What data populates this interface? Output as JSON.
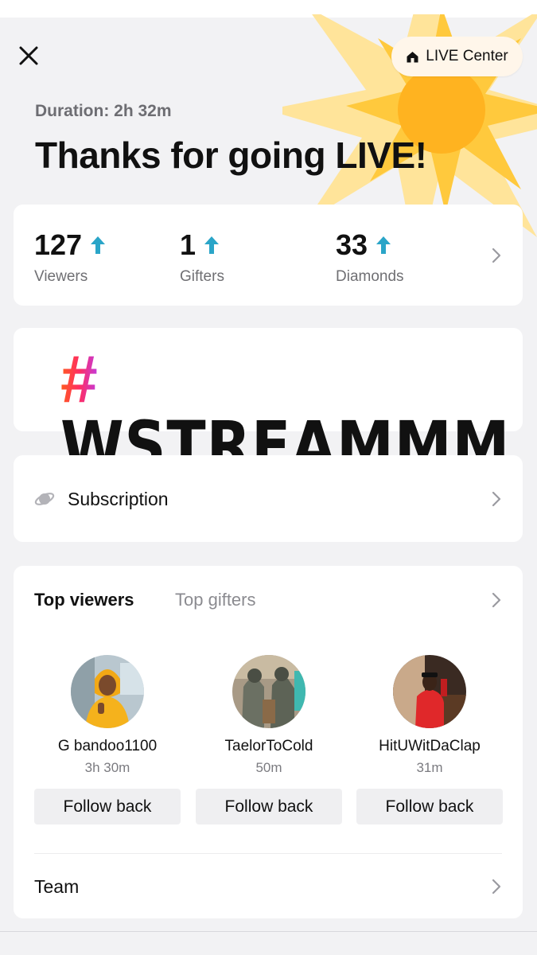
{
  "header": {
    "live_center_label": "LIVE Center",
    "duration": "Duration: 2h 32m",
    "title": "Thanks for going LIVE!"
  },
  "stats": [
    {
      "value": "127",
      "label": "Viewers",
      "trend": "up"
    },
    {
      "value": "1",
      "label": "Gifters",
      "trend": "up"
    },
    {
      "value": "33",
      "label": "Diamonds",
      "trend": "up"
    }
  ],
  "banner": {
    "hash": "#",
    "word": "WSTREAMMM"
  },
  "subscription": {
    "label": "Subscription"
  },
  "top": {
    "tabs": [
      {
        "label": "Top viewers",
        "active": true
      },
      {
        "label": "Top gifters",
        "active": false
      }
    ],
    "viewers": [
      {
        "name": "G bandoo1100",
        "time": "3h 30m",
        "button": "Follow back"
      },
      {
        "name": "TaelorToCold",
        "time": "50m",
        "button": "Follow back"
      },
      {
        "name": "HitUWitDaClap",
        "time": "31m",
        "button": "Follow back"
      }
    ]
  },
  "team": {
    "label": "Team"
  },
  "colors": {
    "accent_arrow": "#2aa5c8",
    "burst": "#ffc22e",
    "burst_light": "#ffe07a"
  },
  "icons": [
    "close-icon",
    "home-icon",
    "arrow-up-icon",
    "chevron-right-icon",
    "subscription-icon"
  ]
}
